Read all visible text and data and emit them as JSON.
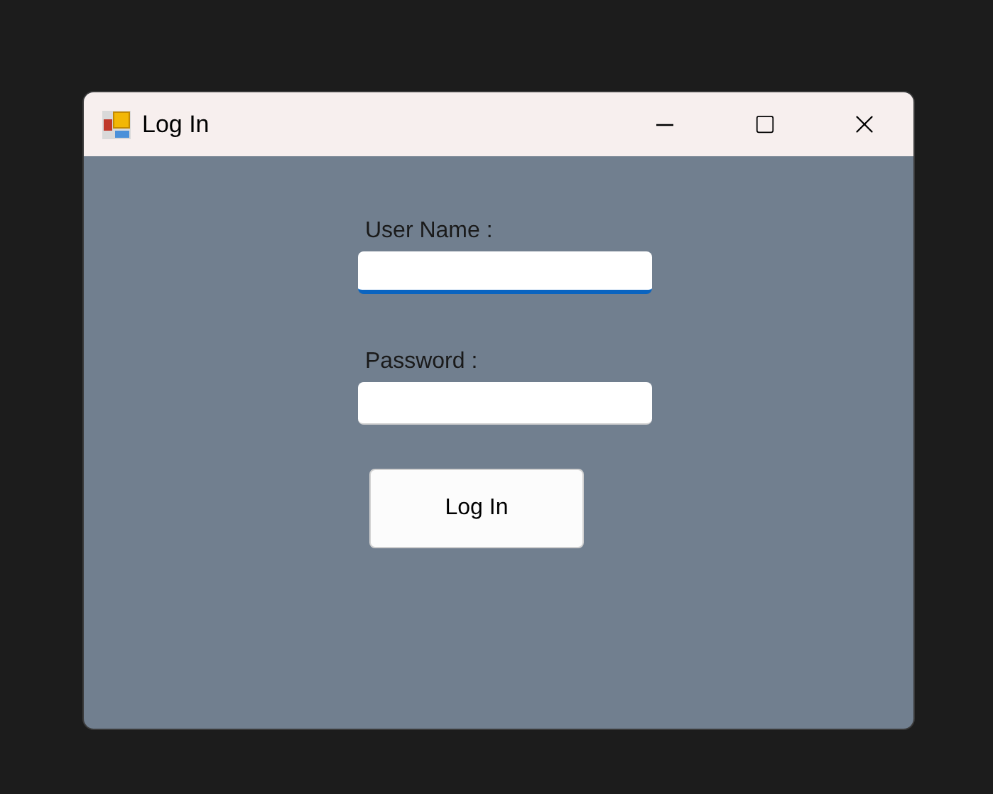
{
  "window": {
    "title": "Log In"
  },
  "fields": [
    {
      "label": "User Name :",
      "focused": true
    },
    {
      "label": "Password :",
      "focused": false
    }
  ],
  "buttons": [
    "Log In"
  ]
}
